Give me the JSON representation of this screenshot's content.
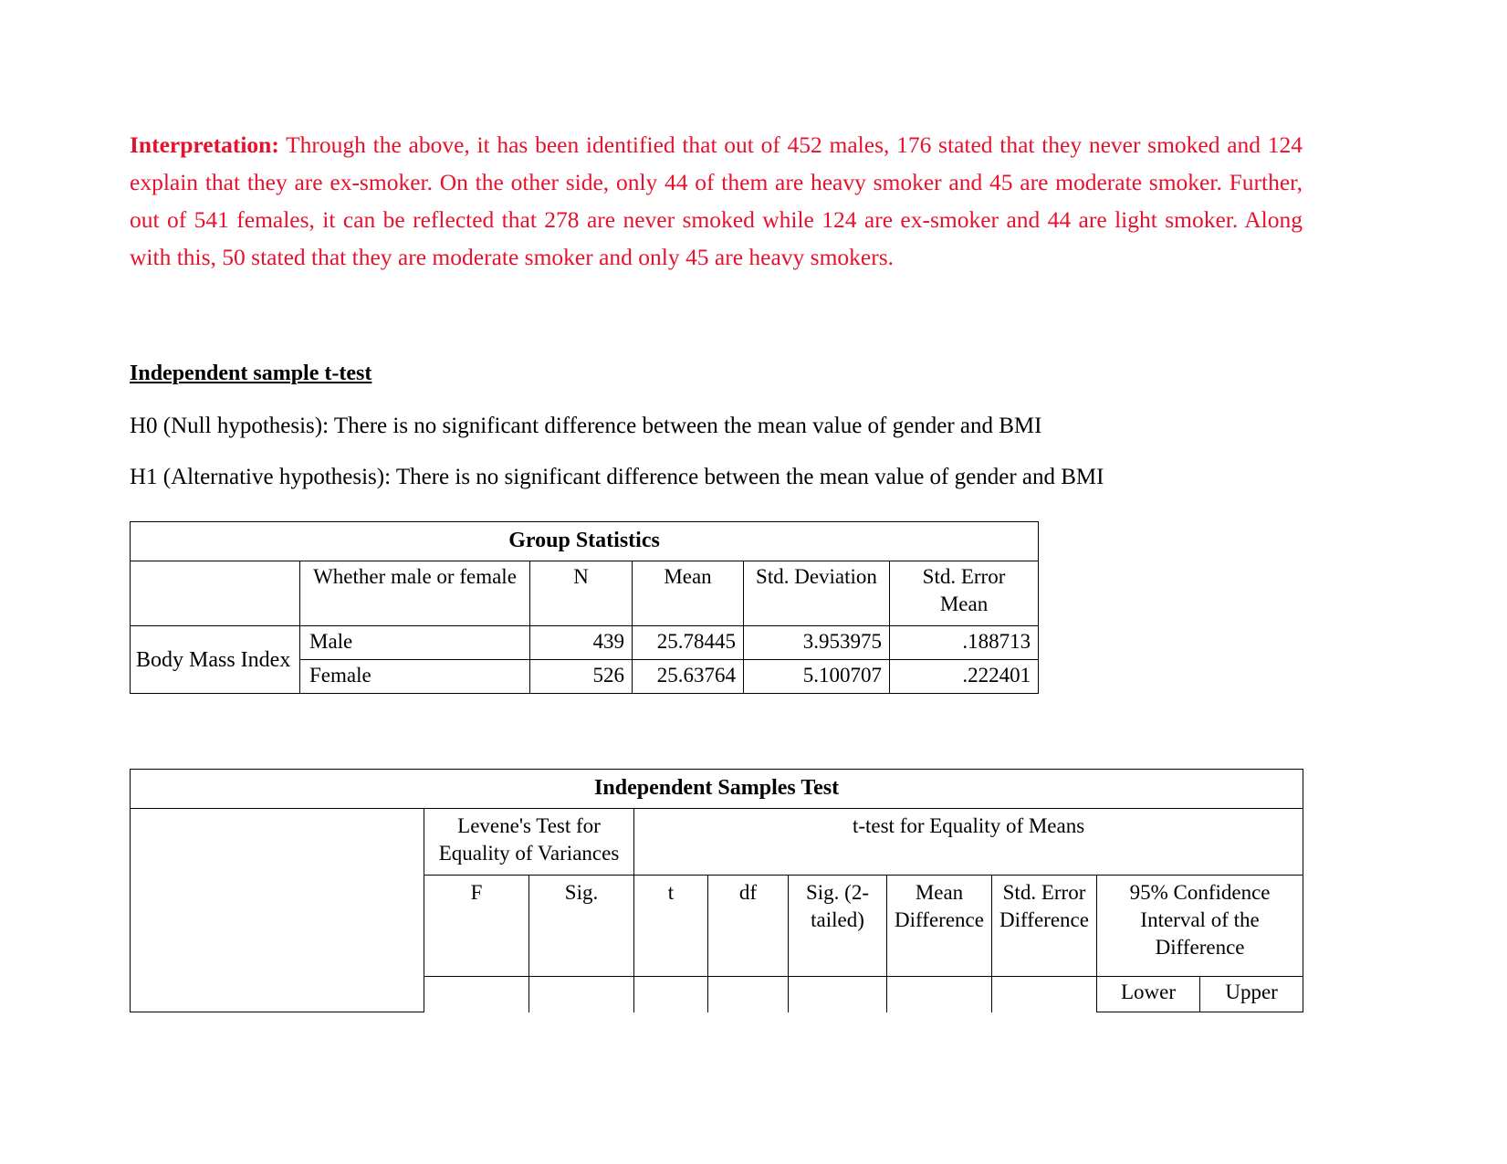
{
  "document": {
    "interpretation": {
      "label": "Interpretation:",
      "body": " Through the above, it has been identified that out of 452 males, 176 stated that they never smoked and 124 explain that they are ex-smoker. On the other side, only 44 of them are heavy smoker and 45 are moderate smoker. Further, out of 541 females, it can be reflected that 278 are never smoked while 124 are ex-smoker and 44 are light smoker. Along with this, 50 stated that they are moderate smoker and only 45 are heavy smokers.",
      "color": "#e8112d"
    },
    "section_heading": "Independent sample t-test",
    "hypotheses": [
      "H0 (Null hypothesis): There is no significant difference between the mean value of gender and BMI",
      "H1 (Alternative hypothesis): There is no significant difference between the mean value of gender and BMI"
    ]
  },
  "group_statistics": {
    "title": "Group Statistics",
    "columns": [
      "Whether male or female",
      "N",
      "Mean",
      "Std. Deviation",
      "Std. Error Mean"
    ],
    "std_error_header_line1": "Std. Error",
    "std_error_header_line2": "Mean",
    "row_label": "Body Mass Index",
    "rows": [
      {
        "group": "Male",
        "n": "439",
        "mean": "25.78445",
        "std_deviation": "3.953975",
        "std_error_mean": ".188713"
      },
      {
        "group": "Female",
        "n": "526",
        "mean": "25.63764",
        "std_deviation": "5.100707",
        "std_error_mean": ".222401"
      }
    ]
  },
  "independent_samples_test": {
    "title": "Independent Samples Test",
    "levene_header_line1": "Levene's Test for",
    "levene_header_line2": "Equality of Variances",
    "ttest_header": "t-test for Equality of Means",
    "columns": {
      "f": "F",
      "sig": "Sig.",
      "t": "t",
      "df": "df",
      "sig2_line1": "Sig. (2-",
      "sig2_line2": "tailed)",
      "mean_diff_line1": "Mean",
      "mean_diff_line2": "Difference",
      "std_err_diff_line1": "Std. Error",
      "std_err_diff_line2": "Difference",
      "ci_line1": "95% Confidence",
      "ci_line2": "Interval of the",
      "ci_line3": "Difference",
      "lower": "Lower",
      "upper": "Upper"
    }
  }
}
